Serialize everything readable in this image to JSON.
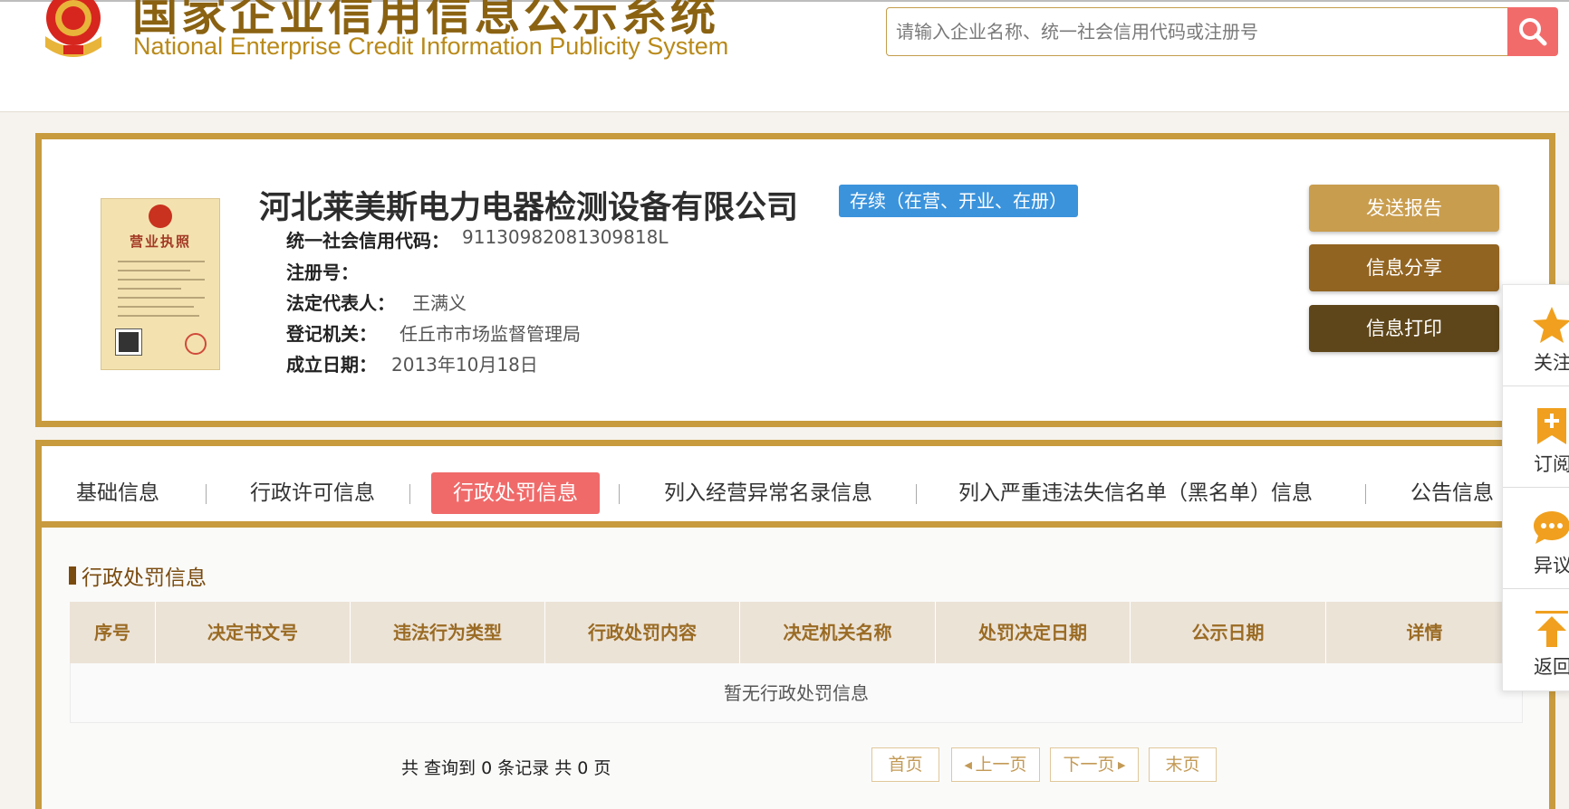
{
  "header": {
    "logo_cn": "国家企业信用信息公示系统",
    "logo_en": "National Enterprise Credit Information Publicity System",
    "search_placeholder": "请输入企业名称、统一社会信用代码或注册号"
  },
  "license_image": {
    "title": "营业执照"
  },
  "company": {
    "name": "河北莱美斯电力电器检测设备有限公司",
    "status": "存续（在营、开业、在册）",
    "fields": [
      {
        "label": "统一社会信用代码：",
        "value": "91130982081309818L"
      },
      {
        "label": "注册号：",
        "value": ""
      },
      {
        "label": "法定代表人：",
        "value": "王满义"
      },
      {
        "label": "登记机关：",
        "value": "任丘市市场监督管理局"
      },
      {
        "label": "成立日期：",
        "value": "2013年10月18日"
      }
    ]
  },
  "actions": {
    "send": "发送报告",
    "share": "信息分享",
    "print": "信息打印"
  },
  "tabs": [
    {
      "label": "基础信息",
      "active": false
    },
    {
      "label": "行政许可信息",
      "active": false
    },
    {
      "label": "行政处罚信息",
      "active": true
    },
    {
      "label": "列入经营异常名录信息",
      "active": false
    },
    {
      "label": "列入严重违法失信名单（黑名单）信息",
      "active": false
    },
    {
      "label": "公告信息",
      "active": false
    }
  ],
  "section": {
    "title": "行政处罚信息",
    "columns": [
      "序号",
      "决定书文号",
      "违法行为类型",
      "行政处罚内容",
      "决定机关名称",
      "处罚决定日期",
      "公示日期",
      "详情"
    ],
    "empty_text": "暂无行政处罚信息"
  },
  "pager": {
    "info": "共 查询到 0 条记录 共 0 页",
    "first": "首页",
    "prev": "上一页",
    "next": "下一页",
    "last": "末页"
  },
  "sidebar": {
    "follow": "关注",
    "subscribe": "订阅",
    "objection": "异议",
    "back": "返回"
  },
  "colors": {
    "gold_border": "#c89b3e",
    "active_tab": "#f06a6a",
    "status_badge": "#3b93dc",
    "search_button": "#f26b6b"
  }
}
